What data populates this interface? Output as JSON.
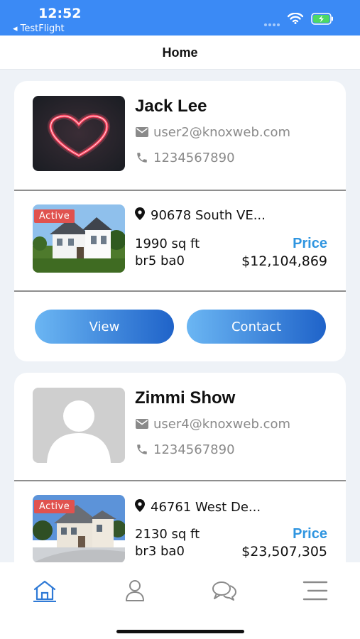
{
  "status_bar": {
    "time": "12:52",
    "back_label": "◂ TestFlight",
    "icons": [
      "wifi-icon",
      "battery-charging-icon"
    ]
  },
  "nav": {
    "title": "Home"
  },
  "listings": [
    {
      "agent_name": "Jack Lee",
      "email": "user2@knoxweb.com",
      "phone": "1234567890",
      "avatar": "neon-heart-image",
      "badge": "Active",
      "address": "90678 South VE...",
      "sqft": "1990 sq ft",
      "rooms": "br5 ba0",
      "price_label": "Price",
      "price": "$12,104,869",
      "view_label": "View",
      "contact_label": "Contact"
    },
    {
      "agent_name": "Zimmi Show",
      "email": "user4@knoxweb.com",
      "phone": "1234567890",
      "avatar": "placeholder-person",
      "badge": "Active",
      "address": "46761 West De...",
      "sqft": "2130 sq ft",
      "rooms": "br3 ba0",
      "price_label": "Price",
      "price": "$23,507,305"
    }
  ],
  "tab_bar": {
    "tabs": [
      "home-icon",
      "profile-icon",
      "chat-icon",
      "menu-icon"
    ],
    "active": "home-icon"
  },
  "colors": {
    "status_bar": "#3b8af5",
    "accent": "#2f95e0",
    "badge": "#e0524f",
    "button_start": "#6bb6f3",
    "button_end": "#1f63c9",
    "background": "#eef2f7"
  }
}
